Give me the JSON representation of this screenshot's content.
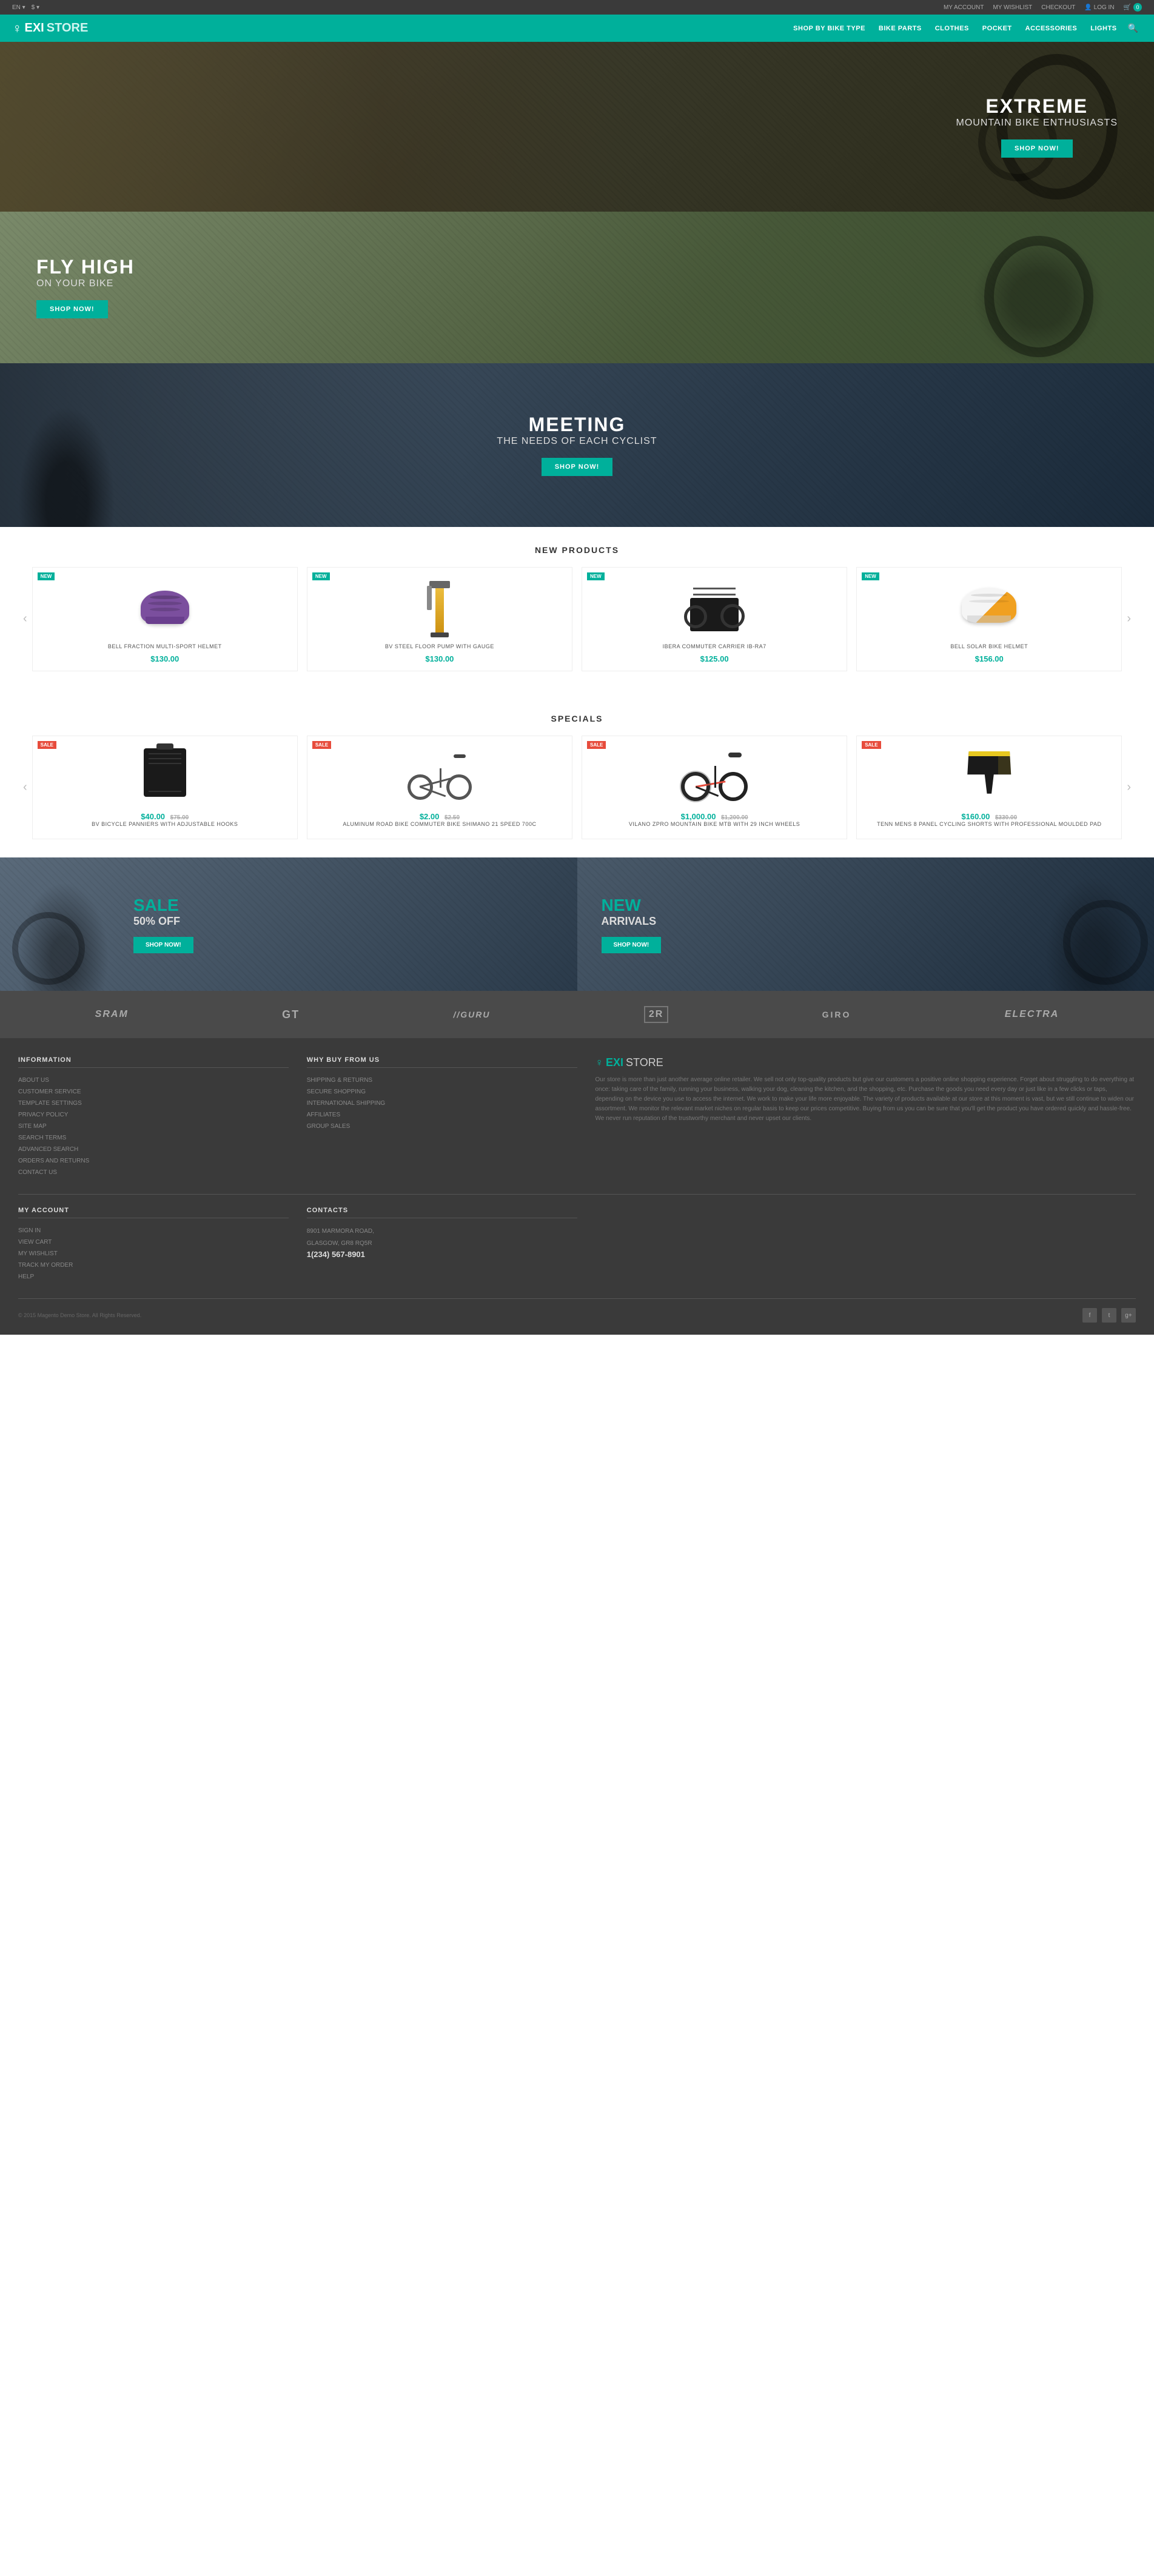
{
  "topbar": {
    "left": {
      "lang": "EN",
      "currency": "$"
    },
    "right": {
      "my_account": "MY ACCOUNT",
      "my_wishlist": "MY WISHLIST",
      "checkout": "CHECKOUT",
      "login": "LOG IN",
      "cart_count": "0"
    }
  },
  "header": {
    "logo_exi": "EXI",
    "logo_store": "STORE",
    "logo_icon": "♀",
    "nav": {
      "shop_by_bike": "SHOP BY BIKE TYPE",
      "bike_parts": "BIKE PARTS",
      "clothes": "CLOTHES",
      "pocket": "POCKET",
      "accessories": "ACCESSORIES",
      "lights": "LIGHTS"
    }
  },
  "hero": {
    "banner1": {
      "title": "EXTREME",
      "subtitle": "MOUNTAIN BIKE ENTHUSIASTS",
      "btn": "SHOP NOW!"
    },
    "banner2": {
      "title": "FLY HIGH",
      "subtitle": "ON YOUR BIKE",
      "btn": "SHOP NOW!"
    },
    "banner3": {
      "title": "MEETING",
      "subtitle": "THE NEEDS OF EACH CYCLIST",
      "btn": "SHOP NOW!"
    }
  },
  "new_products": {
    "section_title": "NEW PRODUCTS",
    "items": [
      {
        "name": "BELL FRACTION MULTI-SPORT HELMET",
        "price": "$130.00",
        "badge": "NEW"
      },
      {
        "name": "BV STEEL FLOOR PUMP WITH GAUGE",
        "price": "$130.00",
        "badge": "NEW"
      },
      {
        "name": "IBERA COMMUTER CARRIER IB-RA7",
        "price": "$125.00",
        "badge": "NEW"
      },
      {
        "name": "BELL SOLAR BIKE HELMET",
        "price": "$156.00",
        "badge": "NEW"
      }
    ]
  },
  "specials": {
    "section_title": "SPECIALS",
    "items": [
      {
        "name": "BV BICYCLE PANNIERS WITH ADJUSTABLE HOOKS",
        "price": "$40.00",
        "price_old": "$75.00",
        "badge": "SALE"
      },
      {
        "name": "ALUMINUM ROAD BIKE COMMUTER BIKE SHIMANO 21 SPEED 700C",
        "price": "$2.00",
        "price_old": "$2.50",
        "badge": "SALE"
      },
      {
        "name": "VILANO ZPRO MOUNTAIN BIKE MTB WITH 29 INCH WHEELS",
        "price": "$1,000.00",
        "price_old": "$1,200.00",
        "badge": "SALE"
      },
      {
        "name": "TENN MENS 8 PANEL CYCLING SHORTS WITH PROFESSIONAL MOULDED PAD",
        "price": "$160.00",
        "price_old": "$330.00",
        "badge": "SALE"
      }
    ]
  },
  "promo": {
    "left": {
      "title_accent": "SALE",
      "subtitle": "50% OFF",
      "btn": "SHOP NOW!"
    },
    "right": {
      "title_accent": "NEW",
      "subtitle": "ARRIVALS",
      "btn": "SHOP NOW!"
    }
  },
  "brands": [
    "SRAM",
    "GT",
    "//GURU",
    "2R",
    "GIRO",
    "Electra"
  ],
  "footer": {
    "information": {
      "title": "INFORMATION",
      "links": [
        "ABOUT US",
        "CUSTOMER SERVICE",
        "TEMPLATE SETTINGS",
        "PRIVACY POLICY",
        "SITE MAP",
        "SEARCH TERMS",
        "ADVANCED SEARCH",
        "ORDERS AND RETURNS",
        "CONTACT US"
      ]
    },
    "why_buy": {
      "title": "WHY BUY FROM US",
      "links": [
        "SHIPPING & RETURNS",
        "SECURE SHOPPING",
        "INTERNATIONAL SHIPPING",
        "AFFILIATES",
        "GROUP SALES"
      ]
    },
    "about": {
      "logo_exi": "EXI",
      "logo_store": "STORE",
      "logo_icon": "♀",
      "description": "Our store is more than just another average online retailer. We sell not only top-quality products but give our customers a positive online shopping experience. Forget about struggling to do everything at once: taking care of the family, running your business, walking your dog, cleaning the kitchen, and the shopping, etc. Purchase the goods you need every day or just like in a few clicks or taps, depending on the device you use to access the internet. We work to make your life more enjoyable. The variety of products available at our store at this moment is vast, but we still continue to widen our assortment. We monitor the relevant market niches on regular basis to keep our prices competitive. Buying from us you can be sure that you'll get the product you have ordered quickly and hassle-free. We never run reputation of the trustworthy merchant and never upset our clients."
    },
    "my_account": {
      "title": "MY ACCOUNT",
      "links": [
        "SIGN IN",
        "VIEW CART",
        "MY WISHLIST",
        "TRACK MY ORDER",
        "HELP"
      ]
    },
    "contacts": {
      "title": "CONTACTS",
      "address": "8901 MARMORA ROAD,\nGLASGOW, GR8 RQ5R",
      "phone": "1(234) 567-8901"
    },
    "copyright": "© 2015 Magento Demo Store. All Rights Reserved.",
    "social": [
      "f",
      "t",
      "g+"
    ]
  }
}
